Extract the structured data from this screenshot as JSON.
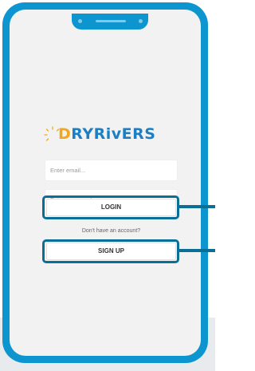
{
  "app": {
    "logo_prefix": "D",
    "logo_main": "RYRivERS",
    "logo_full": "DRYRivERS"
  },
  "login_form": {
    "email_placeholder": "Enter email...",
    "password_placeholder": "Enter password...",
    "login_label": "LOGIN",
    "no_account_text": "Don't have an account?",
    "signup_label": "SIGN UP"
  },
  "colors": {
    "device_frame": "#0d95cf",
    "highlight": "#0b6e97",
    "logo_orange": "#f2a81d",
    "logo_blue": "#1c7fc4"
  }
}
